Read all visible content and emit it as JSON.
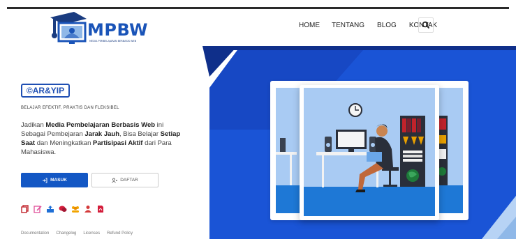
{
  "brand": {
    "logo_text": "MPBW",
    "logo_subtitle": "MEDIA PEMBELAJARAN BERBASIS WEB"
  },
  "nav": {
    "items": [
      "HOME",
      "TENTANG",
      "BLOG",
      "KONTAK"
    ],
    "search_icon": "search-icon"
  },
  "hero": {
    "badge": "©AR&YIP",
    "tagline": "BELAJAR EFEKTIF, PRAKTIS DAN FLEKSIBEL",
    "desc": {
      "p1": "Jadikan ",
      "b1": "Media Pembelajaran Berbasis Web",
      "p2": " ini Sebagai Pembejaran ",
      "b2": "Jarak Jauh",
      "p3": ", Bisa Belajar ",
      "b3": "Setiap Saat",
      "p4": " dan Meningkatkan ",
      "b4": "Partisipasi Aktif",
      "p5": " dari Para Mahasiswa."
    },
    "btn_masuk": "MASUK",
    "btn_daftar": "DAFTAR"
  },
  "social_icons": [
    "copy-icon",
    "edit-icon",
    "upload-icon",
    "chat-icon",
    "users-icon",
    "user-icon",
    "pdf-icon"
  ],
  "footer": {
    "links": [
      "Documentation",
      "Changelog",
      "Licenses",
      "Refund Policy"
    ]
  },
  "colors": {
    "primary": "#1357c4",
    "dark_blue": "#0f2f8a",
    "light_blue": "#a9cbf3",
    "room_floor": "#1e78d6"
  }
}
